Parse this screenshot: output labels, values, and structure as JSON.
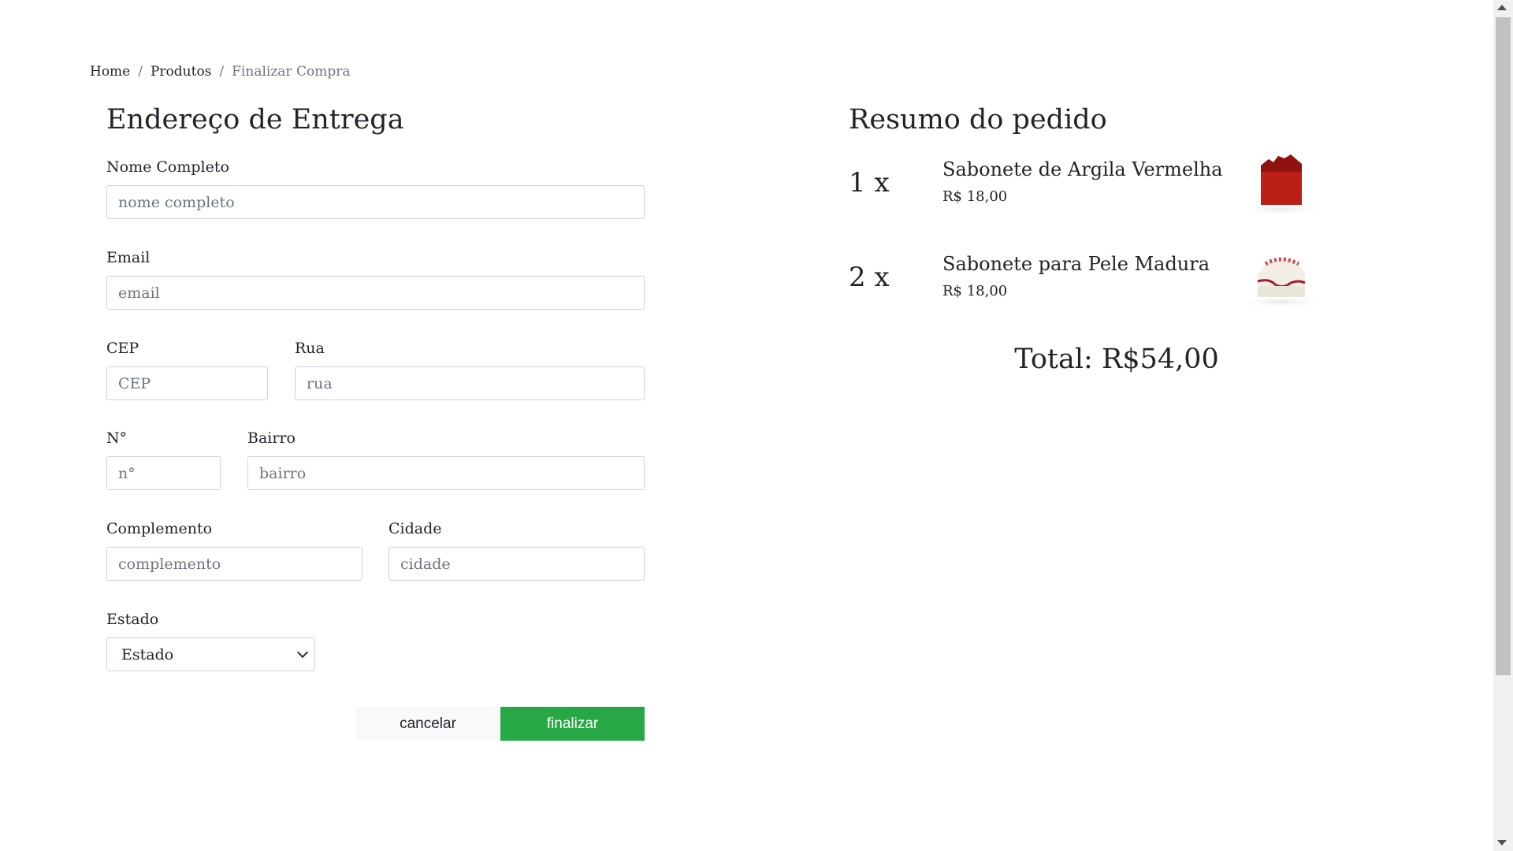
{
  "breadcrumb": {
    "home": "Home",
    "produtos": "Produtos",
    "current": "Finalizar Compra",
    "separator": "/"
  },
  "form": {
    "title": "Endereço de Entrega",
    "nome": {
      "label": "Nome Completo",
      "placeholder": "nome completo"
    },
    "email": {
      "label": "Email",
      "placeholder": "email"
    },
    "cep": {
      "label": "CEP",
      "placeholder": "CEP"
    },
    "rua": {
      "label": "Rua",
      "placeholder": "rua"
    },
    "numero": {
      "label": "N°",
      "placeholder": "n°"
    },
    "bairro": {
      "label": "Bairro",
      "placeholder": "bairro"
    },
    "complemento": {
      "label": "Complemento",
      "placeholder": "complemento"
    },
    "cidade": {
      "label": "Cidade",
      "placeholder": "cidade"
    },
    "estado": {
      "label": "Estado",
      "selected": "Estado"
    },
    "cancel_label": "cancelar",
    "finish_label": "finalizar"
  },
  "summary": {
    "title": "Resumo do pedido",
    "items": [
      {
        "qty": "1 x",
        "name": "Sabonete de Argila Vermelha",
        "price": "R$ 18,00",
        "image_icon": "red-clay-soap-image"
      },
      {
        "qty": "2 x",
        "name": "Sabonete para Pele Madura",
        "price": "R$ 18,00",
        "image_icon": "white-soap-image"
      }
    ],
    "total": "Total: R$54,00"
  },
  "colors": {
    "accent": "#28a745",
    "text": "#212529",
    "muted": "#6c757d",
    "border": "#ced4da"
  }
}
